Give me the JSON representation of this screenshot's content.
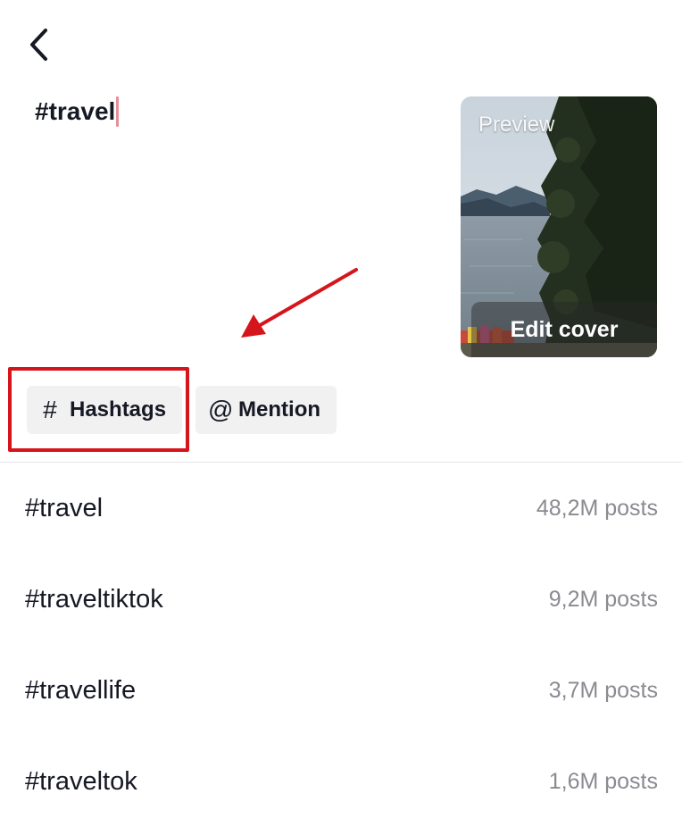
{
  "header": {
    "back_icon": "chevron-left-icon"
  },
  "caption": {
    "text": "#travel"
  },
  "cover": {
    "preview_label": "Preview",
    "edit_label": "Edit cover"
  },
  "annotation": {
    "arrow_color": "#d6141b",
    "highlight_color": "#d6141b"
  },
  "tools": {
    "hashtags": {
      "icon": "#",
      "label": "Hashtags"
    },
    "mention": {
      "icon": "@",
      "label": "Mention"
    }
  },
  "suggestions": [
    {
      "tag": "#travel",
      "posts": "48,2M posts"
    },
    {
      "tag": "#traveltiktok",
      "posts": "9,2M posts"
    },
    {
      "tag": "#travellife",
      "posts": "3,7M posts"
    },
    {
      "tag": "#traveltok",
      "posts": "1,6M posts"
    }
  ]
}
